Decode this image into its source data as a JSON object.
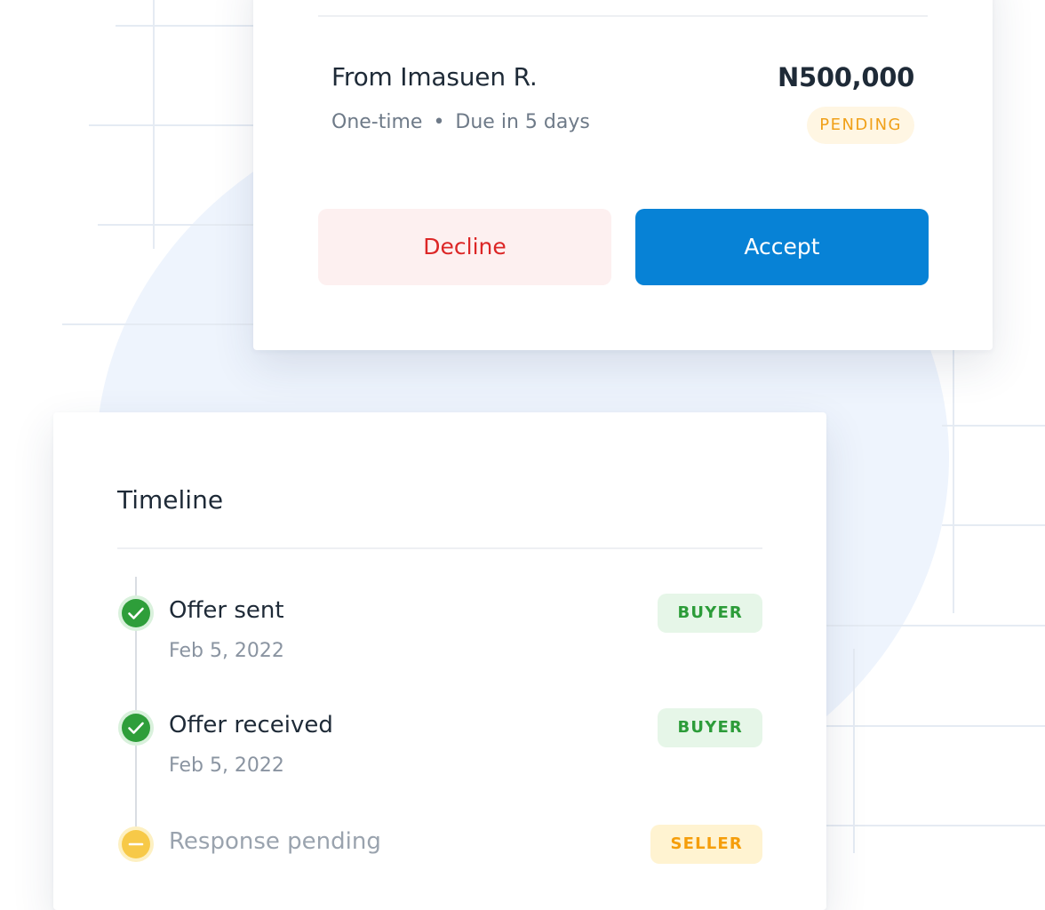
{
  "offer": {
    "from": "From Imasuen R.",
    "amount": "N500,000",
    "frequency": "One-time",
    "separator": "•",
    "due": "Due in 5 days",
    "status": "PENDING",
    "decline_label": "Decline",
    "accept_label": "Accept"
  },
  "timeline": {
    "title": "Timeline",
    "items": [
      {
        "label": "Offer sent",
        "date": "Feb 5, 2022",
        "role": "BUYER",
        "state": "complete"
      },
      {
        "label": "Offer received",
        "date": "Feb 5, 2022",
        "role": "BUYER",
        "state": "complete"
      },
      {
        "label": "Response pending",
        "role": "SELLER",
        "state": "pending"
      }
    ]
  },
  "colors": {
    "accent": "#0782d6",
    "decline_text": "#dc2626",
    "decline_bg": "#fdf0f0",
    "pending_text": "#f0a019",
    "pending_bg": "#fff6e3",
    "success": "#2c9c39",
    "success_bg": "#e6f6e8",
    "seller_text": "#f59e0b",
    "seller_bg": "#fff3d1",
    "complete_icon": "#2e9e3a",
    "pending_icon": "#f7c948"
  },
  "icons": {
    "complete": "check-circle-icon",
    "pending": "minus-circle-icon"
  }
}
